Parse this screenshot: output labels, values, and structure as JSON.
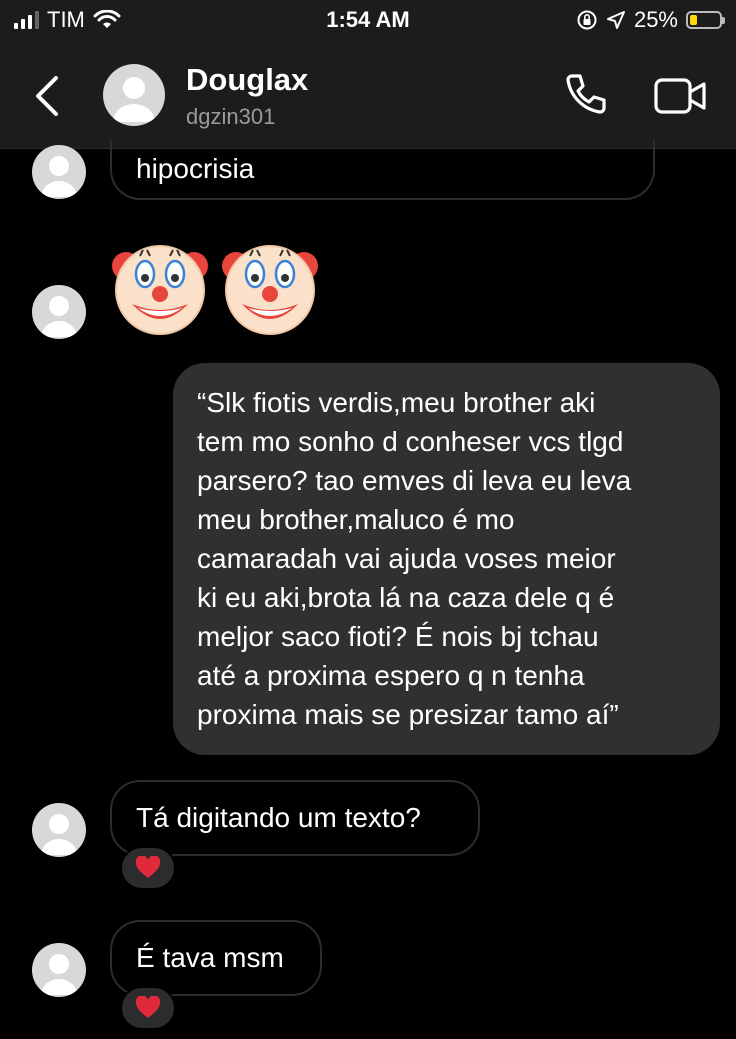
{
  "status_bar": {
    "carrier": "TIM",
    "time": "1:54 AM",
    "battery_percent": "25%",
    "battery_level": 0.25,
    "signal_bars": 3,
    "icons": [
      "signal-icon",
      "wifi-icon",
      "orientation-lock-icon",
      "location-arrow-icon",
      "battery-icon"
    ]
  },
  "header": {
    "name": "Douglax",
    "username": "dgzin301",
    "icons": [
      "back-chevron-icon",
      "avatar",
      "phone-icon",
      "video-camera-icon"
    ]
  },
  "messages": [
    {
      "direction": "incoming",
      "type": "text",
      "text": "hipocrisia"
    },
    {
      "direction": "incoming",
      "type": "emoji",
      "emoji": [
        "clown-face-icon",
        "clown-face-icon"
      ]
    },
    {
      "direction": "outgoing",
      "type": "text",
      "lines": [
        "“Slk fiotis verdis,meu brother aki",
        "tem mo sonho d conheser vcs tlgd",
        "parsero? tao emves di leva eu leva",
        "meu brother,maluco é mo",
        "camaradah vai ajuda voses meior",
        "ki eu aki,brota lá na caza dele q é",
        "meljor saco fioti? É nois bj tchau",
        "até a proxima espero q n tenha",
        "proxima mais se presizar tamo aí”"
      ]
    },
    {
      "direction": "incoming",
      "type": "text",
      "text": "Tá digitando um texto?",
      "reaction": "red-heart-icon"
    },
    {
      "direction": "incoming",
      "type": "text",
      "text": "É tava msm",
      "reaction": "red-heart-icon"
    }
  ],
  "colors": {
    "background": "#000000",
    "bar": "#1c1c1e",
    "outgoing_bubble": "#303030",
    "incoming_border": "#2c2c2e",
    "heart": "#e0293a",
    "battery": "#ffd60a"
  }
}
